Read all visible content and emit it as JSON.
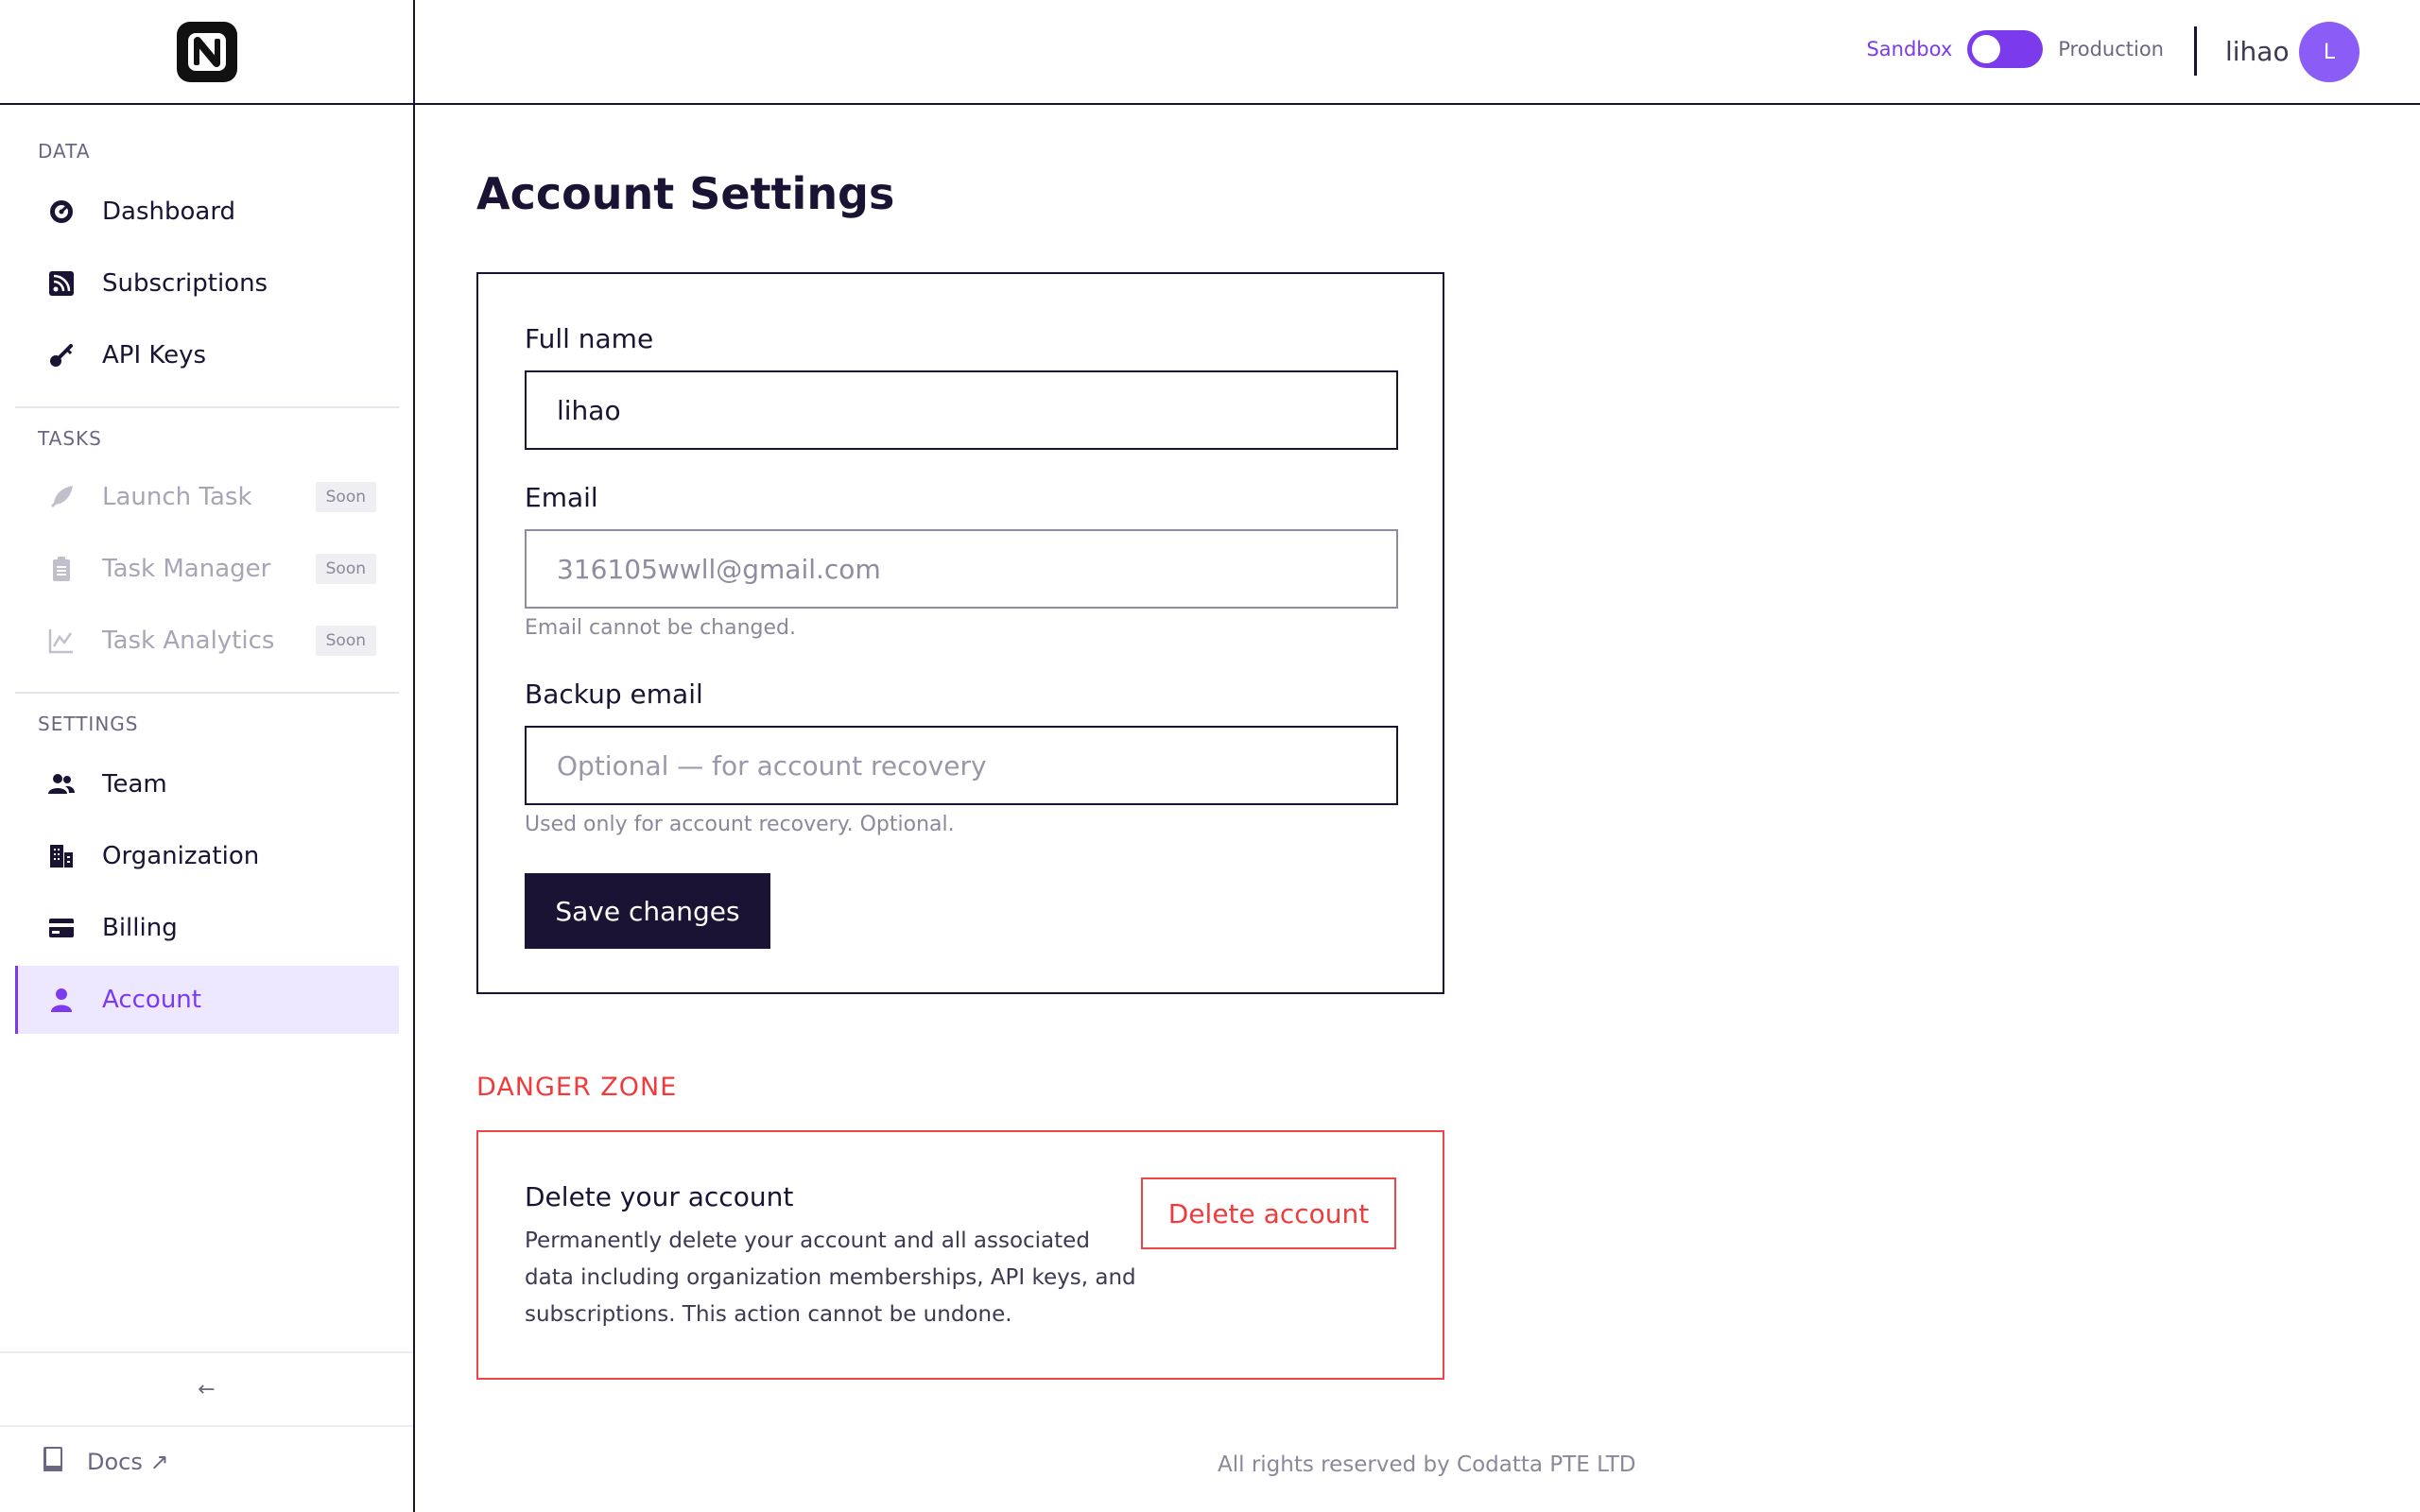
{
  "header": {
    "env_sandbox": "Sandbox",
    "env_production": "Production",
    "username": "lihao",
    "avatar_initial": "L"
  },
  "sidebar": {
    "sections": {
      "data": "DATA",
      "tasks": "TASKS",
      "settings": "SETTINGS"
    },
    "data_items": [
      {
        "label": "Dashboard",
        "icon": "gauge-icon"
      },
      {
        "label": "Subscriptions",
        "icon": "rss-icon"
      },
      {
        "label": "API Keys",
        "icon": "key-icon"
      }
    ],
    "task_items": [
      {
        "label": "Launch Task",
        "icon": "rocket-icon",
        "badge": "Soon"
      },
      {
        "label": "Task Manager",
        "icon": "clipboard-icon",
        "badge": "Soon"
      },
      {
        "label": "Task Analytics",
        "icon": "chart-icon",
        "badge": "Soon"
      }
    ],
    "settings_items": [
      {
        "label": "Team",
        "icon": "users-icon"
      },
      {
        "label": "Organization",
        "icon": "building-icon"
      },
      {
        "label": "Billing",
        "icon": "card-icon"
      },
      {
        "label": "Account",
        "icon": "user-icon",
        "active": true
      }
    ],
    "collapse": "←",
    "docs": "Docs ↗"
  },
  "main": {
    "title": "Account Settings",
    "form": {
      "full_name_label": "Full name",
      "full_name_value": "lihao",
      "email_label": "Email",
      "email_value": "316105wwll@gmail.com",
      "email_help": "Email cannot be changed.",
      "backup_label": "Backup email",
      "backup_placeholder": "Optional — for account recovery",
      "backup_help": "Used only for account recovery. Optional.",
      "save_label": "Save changes"
    },
    "danger": {
      "label": "DANGER ZONE",
      "title": "Delete your account",
      "description": "Permanently delete your account and all associated data including organization memberships, API keys, and subscriptions. This action cannot be undone.",
      "button": "Delete account"
    },
    "footer": "All rights reserved by Codatta PTE LTD"
  },
  "colors": {
    "accent": "#7c3aed",
    "dark": "#1a1333",
    "danger": "#ef4444"
  }
}
